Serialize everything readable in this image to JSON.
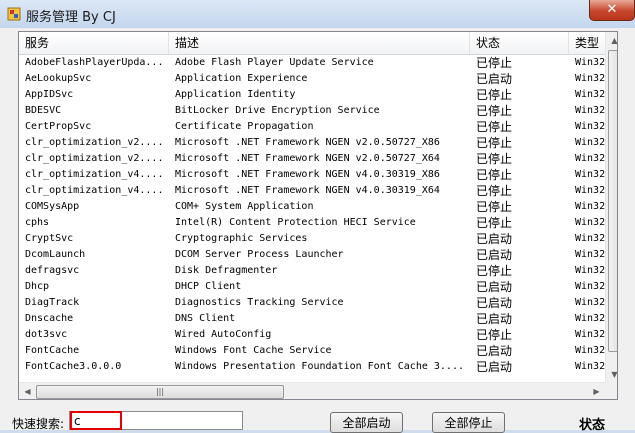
{
  "window": {
    "title": "服务管理 By CJ",
    "close_label": "✕"
  },
  "columns": [
    "服务",
    "描述",
    "状态",
    "类型"
  ],
  "rows": [
    {
      "name": "AdobeFlashPlayerUpda...",
      "desc": "Adobe Flash Player Update Service",
      "status": "已停止",
      "type": "Win32"
    },
    {
      "name": "AeLookupSvc",
      "desc": "Application Experience",
      "status": "已启动",
      "type": "Win32"
    },
    {
      "name": "AppIDSvc",
      "desc": "Application Identity",
      "status": "已停止",
      "type": "Win32"
    },
    {
      "name": "BDESVC",
      "desc": "BitLocker Drive Encryption Service",
      "status": "已停止",
      "type": "Win32"
    },
    {
      "name": "CertPropSvc",
      "desc": "Certificate Propagation",
      "status": "已停止",
      "type": "Win32"
    },
    {
      "name": "clr_optimization_v2....",
      "desc": "Microsoft .NET Framework NGEN v2.0.50727_X86",
      "status": "已停止",
      "type": "Win32"
    },
    {
      "name": "clr_optimization_v2....",
      "desc": "Microsoft .NET Framework NGEN v2.0.50727_X64",
      "status": "已停止",
      "type": "Win32"
    },
    {
      "name": "clr_optimization_v4....",
      "desc": "Microsoft .NET Framework NGEN v4.0.30319_X86",
      "status": "已停止",
      "type": "Win32"
    },
    {
      "name": "clr_optimization_v4....",
      "desc": "Microsoft .NET Framework NGEN v4.0.30319_X64",
      "status": "已停止",
      "type": "Win32"
    },
    {
      "name": "COMSysApp",
      "desc": "COM+ System Application",
      "status": "已停止",
      "type": "Win32"
    },
    {
      "name": "cphs",
      "desc": "Intel(R) Content Protection HECI Service",
      "status": "已停止",
      "type": "Win32"
    },
    {
      "name": "CryptSvc",
      "desc": "Cryptographic Services",
      "status": "已启动",
      "type": "Win32"
    },
    {
      "name": "DcomLaunch",
      "desc": "DCOM Server Process Launcher",
      "status": "已启动",
      "type": "Win32"
    },
    {
      "name": "defragsvc",
      "desc": "Disk Defragmenter",
      "status": "已停止",
      "type": "Win32"
    },
    {
      "name": "Dhcp",
      "desc": "DHCP Client",
      "status": "已启动",
      "type": "Win32"
    },
    {
      "name": "DiagTrack",
      "desc": "Diagnostics Tracking Service",
      "status": "已启动",
      "type": "Win32"
    },
    {
      "name": "Dnscache",
      "desc": "DNS Client",
      "status": "已启动",
      "type": "Win32"
    },
    {
      "name": "dot3svc",
      "desc": "Wired AutoConfig",
      "status": "已停止",
      "type": "Win32"
    },
    {
      "name": "FontCache",
      "desc": "Windows Font Cache Service",
      "status": "已启动",
      "type": "Win32"
    },
    {
      "name": "FontCache3.0.0.0",
      "desc": "Windows Presentation Foundation Font Cache 3....",
      "status": "已启动",
      "type": "Win32"
    }
  ],
  "bottom": {
    "search_label": "快速搜索:",
    "search_value": "c",
    "start_all_label": "全部启动",
    "stop_all_label": "全部停止",
    "status_label": "状态"
  },
  "icons": {
    "app": "app-window-icon",
    "scroll_up": "▲",
    "scroll_down": "▼",
    "scroll_left": "◀",
    "scroll_right": "▶",
    "grip": "|||"
  },
  "colors": {
    "titlebar": "#c4d6ee",
    "close": "#c7472d",
    "highlight": "#e60000"
  }
}
